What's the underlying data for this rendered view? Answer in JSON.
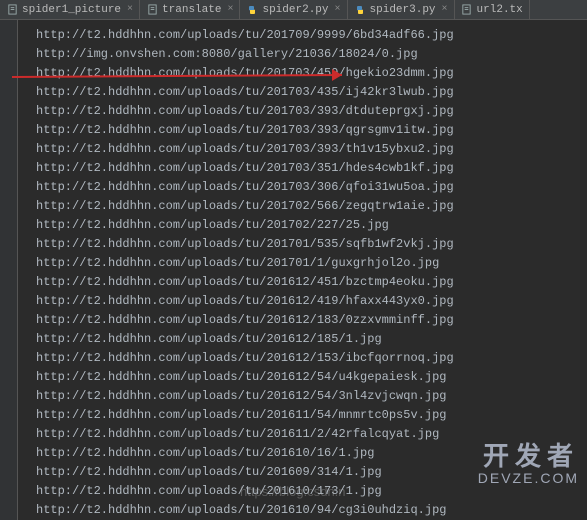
{
  "tabs": [
    {
      "label": "spider1_picture",
      "icon": "file"
    },
    {
      "label": "translate",
      "icon": "file"
    },
    {
      "label": "spider2.py",
      "icon": "python"
    },
    {
      "label": "spider3.py",
      "icon": "python"
    },
    {
      "label": "url2.tx",
      "icon": "file"
    }
  ],
  "lines": [
    "http://t2.hddhhn.com/uploads/tu/201709/9999/6bd34adf66.jpg",
    "http://img.onvshen.com:8080/gallery/21036/18024/0.jpg",
    "http://t2.hddhhn.com/uploads/tu/201703/459/hgekio23dmm.jpg",
    "http://t2.hddhhn.com/uploads/tu/201703/435/ij42kr3lwub.jpg",
    "http://t2.hddhhn.com/uploads/tu/201703/393/dtduteprgxj.jpg",
    "http://t2.hddhhn.com/uploads/tu/201703/393/qgrsgmv1itw.jpg",
    "http://t2.hddhhn.com/uploads/tu/201703/393/th1v15ybxu2.jpg",
    "http://t2.hddhhn.com/uploads/tu/201703/351/hdes4cwb1kf.jpg",
    "http://t2.hddhhn.com/uploads/tu/201703/306/qfoi31wu5oa.jpg",
    "http://t2.hddhhn.com/uploads/tu/201702/566/zegqtrw1aie.jpg",
    "http://t2.hddhhn.com/uploads/tu/201702/227/25.jpg",
    "http://t2.hddhhn.com/uploads/tu/201701/535/sqfb1wf2vkj.jpg",
    "http://t2.hddhhn.com/uploads/tu/201701/1/guxgrhjol2o.jpg",
    "http://t2.hddhhn.com/uploads/tu/201612/451/bzctmp4eoku.jpg",
    "http://t2.hddhhn.com/uploads/tu/201612/419/hfaxx443yx0.jpg",
    "http://t2.hddhhn.com/uploads/tu/201612/183/0zzxvmminff.jpg",
    "http://t2.hddhhn.com/uploads/tu/201612/185/1.jpg",
    "http://t2.hddhhn.com/uploads/tu/201612/153/ibcfqorrnoq.jpg",
    "http://t2.hddhhn.com/uploads/tu/201612/54/u4kgepaiesk.jpg",
    "http://t2.hddhhn.com/uploads/tu/201612/54/3nl4zvjcwqn.jpg",
    "http://t2.hddhhn.com/uploads/tu/201611/54/mnmrtc0ps5v.jpg",
    "http://t2.hddhhn.com/uploads/tu/201611/2/42rfalcqyat.jpg",
    "http://t2.hddhhn.com/uploads/tu/201610/16/1.jpg",
    "http://t2.hddhhn.com/uploads/tu/201609/314/1.jpg",
    "http://t2.hddhhn.com/uploads/tu/201610/173/1.jpg",
    "http://t2.hddhhn.com/uploads/tu/201610/94/cg3i0uhdziq.jpg"
  ],
  "watermark": {
    "main": "开发者",
    "sub": "DEVZE.COM"
  },
  "csdn": "https://blog.csdn.n"
}
